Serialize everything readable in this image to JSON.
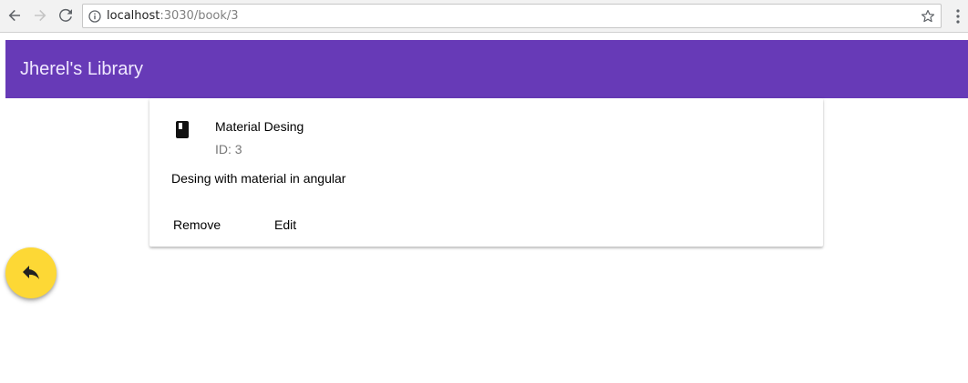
{
  "browser": {
    "url_host": "localhost",
    "url_rest": ":3030/book/3",
    "icons": [
      "back-arrow-icon",
      "forward-arrow-icon",
      "reload-icon",
      "info-icon",
      "star-icon",
      "menu-dots-icon"
    ]
  },
  "toolbar": {
    "title": "Jherel's Library",
    "color": "#673ab7"
  },
  "card": {
    "avatar_icon": "book-icon",
    "title": "Material Desing",
    "subtitle": "ID: 3",
    "content": "Desing with material in angular",
    "actions": {
      "remove_label": "Remove",
      "edit_label": "Edit"
    }
  },
  "fab": {
    "icon": "reply-icon",
    "color": "#fdd835"
  }
}
